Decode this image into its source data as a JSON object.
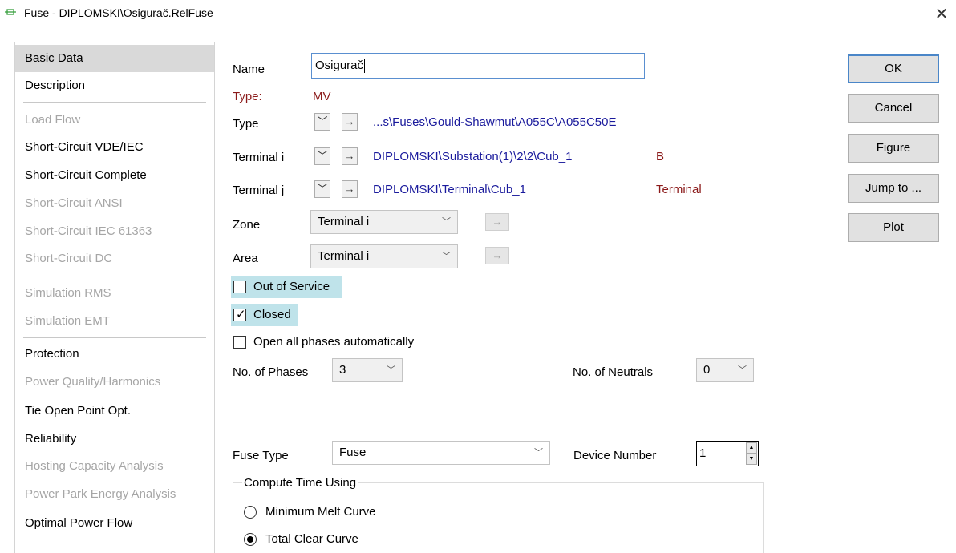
{
  "window": {
    "title": "Fuse - DIPLOMSKI\\Osigurač.RelFuse",
    "close_glyph": "✕",
    "icon": "fuse-icon"
  },
  "sidebar": {
    "items": [
      {
        "label": "Basic Data",
        "state": "selected"
      },
      {
        "label": "Description",
        "state": "enabled"
      },
      {
        "label": "Load Flow",
        "state": "disabled"
      },
      {
        "label": "Short-Circuit VDE/IEC",
        "state": "enabled"
      },
      {
        "label": "Short-Circuit Complete",
        "state": "enabled"
      },
      {
        "label": "Short-Circuit ANSI",
        "state": "disabled"
      },
      {
        "label": "Short-Circuit IEC 61363",
        "state": "disabled"
      },
      {
        "label": "Short-Circuit DC",
        "state": "disabled"
      },
      {
        "label": "Simulation RMS",
        "state": "disabled"
      },
      {
        "label": "Simulation EMT",
        "state": "disabled"
      },
      {
        "label": "Protection",
        "state": "enabled"
      },
      {
        "label": "Power Quality/Harmonics",
        "state": "disabled"
      },
      {
        "label": "Tie Open Point Opt.",
        "state": "enabled"
      },
      {
        "label": "Reliability",
        "state": "enabled"
      },
      {
        "label": "Hosting Capacity Analysis",
        "state": "disabled"
      },
      {
        "label": "Power Park Energy Analysis",
        "state": "disabled"
      },
      {
        "label": "Optimal Power Flow",
        "state": "enabled"
      }
    ]
  },
  "form": {
    "name_label": "Name",
    "name_value": "Osigurač",
    "type_info_label": "Type:",
    "type_info_value": "MV",
    "type_label": "Type",
    "type_link": "...s\\Fuses\\Gould-Shawmut\\A055C\\A055C50E",
    "terminal_i_label": "Terminal i",
    "terminal_i_link": "DIPLOMSKI\\Substation(1)\\2\\2\\Cub_1",
    "terminal_i_tag": "B",
    "terminal_j_label": "Terminal j",
    "terminal_j_link": "DIPLOMSKI\\Terminal\\Cub_1",
    "terminal_j_tag": "Terminal",
    "zone_label": "Zone",
    "zone_value": "Terminal i",
    "area_label": "Area",
    "area_value": "Terminal i",
    "out_of_service_label": "Out of Service",
    "out_of_service_checked": false,
    "closed_label": "Closed",
    "closed_checked": true,
    "open_all_label": "Open all phases automatically",
    "open_all_checked": false,
    "phases_label": "No. of Phases",
    "phases_value": "3",
    "neutrals_label": "No. of Neutrals",
    "neutrals_value": "0",
    "fuse_type_label": "Fuse Type",
    "fuse_type_value": "Fuse",
    "device_number_label": "Device Number",
    "device_number_value": "1",
    "compute_group_label": "Compute Time Using",
    "compute_options": [
      {
        "label": "Minimum Melt Curve",
        "selected": false
      },
      {
        "label": "Total Clear Curve",
        "selected": true
      }
    ]
  },
  "buttons": {
    "ok": "OK",
    "cancel": "Cancel",
    "figure": "Figure",
    "jump_to": "Jump to ...",
    "plot": "Plot"
  },
  "glyphs": {
    "dropdown": "﹀",
    "arrow": "→",
    "check": "✓"
  },
  "colors": {
    "link": "#1a1a9c",
    "dark_red": "#8b1a1a",
    "highlight": "#bfe3ea",
    "default_button_border": "#4a86c8"
  }
}
